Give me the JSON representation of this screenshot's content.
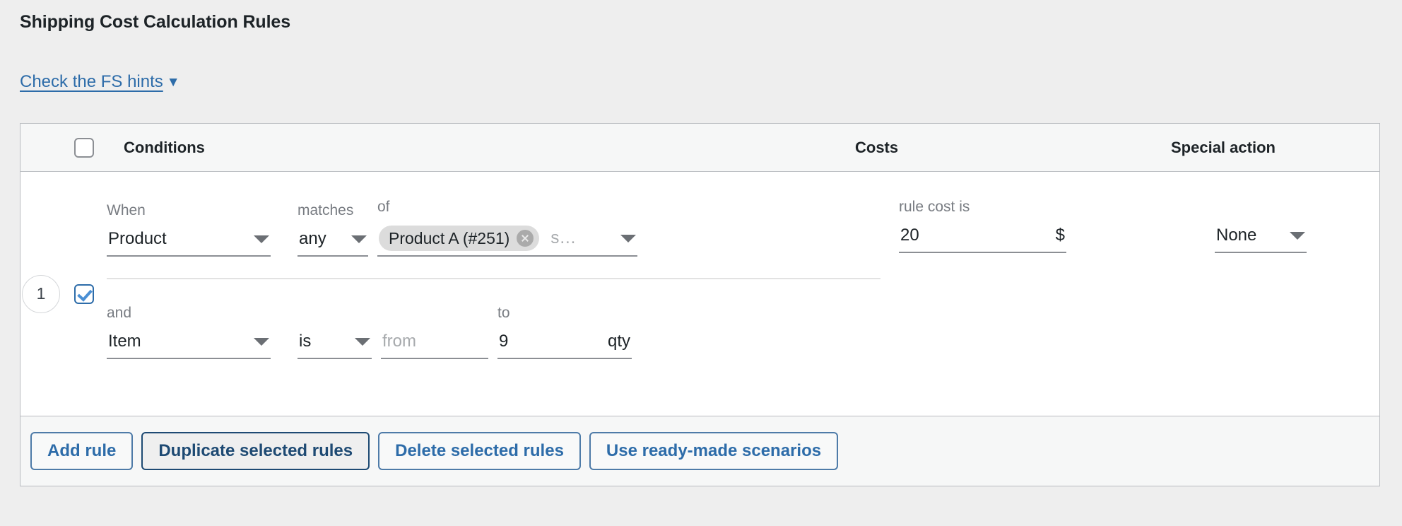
{
  "page": {
    "title": "Shipping Cost Calculation Rules",
    "hints_link": "Check the FS hints",
    "hints_caret": "▼"
  },
  "table": {
    "header": {
      "select_all_checkbox": "select-all",
      "conditions": "Conditions",
      "costs": "Costs",
      "special_action": "Special action"
    },
    "rules": [
      {
        "number": "1",
        "selected": true,
        "conditions": [
          {
            "prefix_label": "When",
            "subject": "Product",
            "operator_label": "matches",
            "operator": "any",
            "value_label": "of",
            "chips": [
              {
                "text": "Product A (#251)"
              }
            ],
            "value_placeholder": "s…"
          },
          {
            "prefix_label": "and",
            "subject": "Item",
            "operator_label": "",
            "operator": "is",
            "from_label": "",
            "from_value": "",
            "from_placeholder": "from",
            "to_label": "to",
            "to_value": "9",
            "unit": "qty"
          }
        ],
        "cost": {
          "label": "rule cost is",
          "value": "20",
          "currency": "$"
        },
        "special_action": "None"
      }
    ]
  },
  "footer": {
    "buttons": [
      {
        "label": "Add rule",
        "focused": false
      },
      {
        "label": "Duplicate selected rules",
        "focused": true
      },
      {
        "label": "Delete selected rules",
        "focused": false
      },
      {
        "label": "Use ready-made scenarios",
        "focused": false
      }
    ]
  },
  "colors": {
    "link": "#2d6ca9",
    "page_bg": "#eeeeee",
    "table_border": "#b9bcc0",
    "header_bg": "#f6f7f7",
    "checkbox_accent": "#2d6ca9"
  }
}
